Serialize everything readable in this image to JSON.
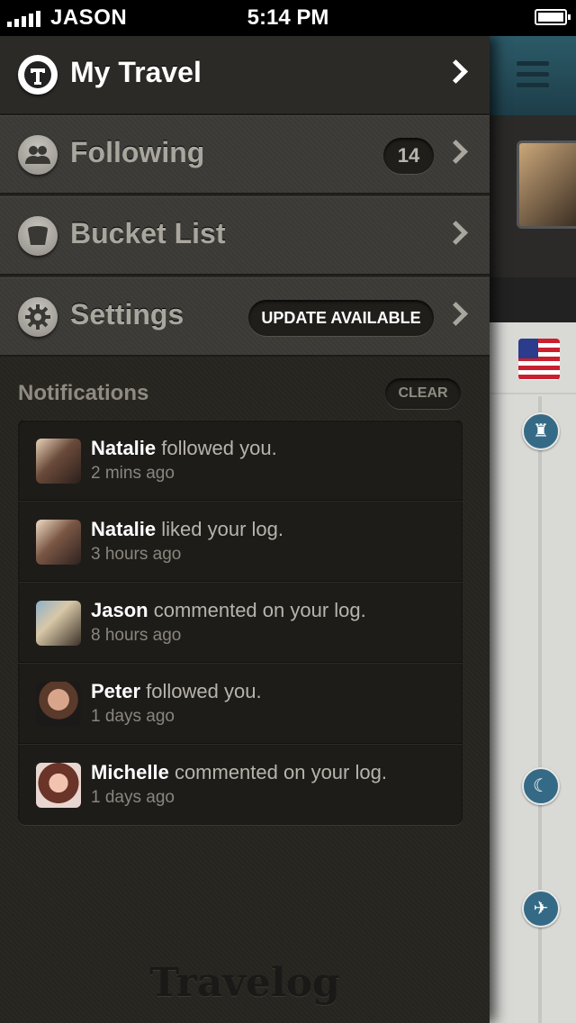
{
  "status_bar": {
    "carrier": "JASON",
    "time": "5:14 PM"
  },
  "menu": [
    {
      "label": "My Travel",
      "icon": "travelog-t-icon",
      "active": true
    },
    {
      "label": "Following",
      "icon": "people-icon",
      "badge": "14"
    },
    {
      "label": "Bucket List",
      "icon": "bucket-icon"
    },
    {
      "label": "Settings",
      "icon": "gear-icon",
      "badge": "UPDATE AVAILABLE"
    }
  ],
  "notifications": {
    "title": "Notifications",
    "clear_label": "CLEAR",
    "items": [
      {
        "name": "Natalie",
        "action": "followed you.",
        "time": "2 mins ago"
      },
      {
        "name": "Natalie",
        "action": "liked your log.",
        "time": "3 hours ago"
      },
      {
        "name": "Jason",
        "action": "commented on your log.",
        "time": "8 hours ago"
      },
      {
        "name": "Peter",
        "action": "followed you.",
        "time": "1 days ago"
      },
      {
        "name": "Michelle",
        "action": "commented on your log.",
        "time": "1 days ago"
      }
    ]
  },
  "brand": "Travelog",
  "colors": {
    "active_label": "#ffffff",
    "inactive_label": "#a9a69e",
    "map_pin": "#356a86"
  }
}
